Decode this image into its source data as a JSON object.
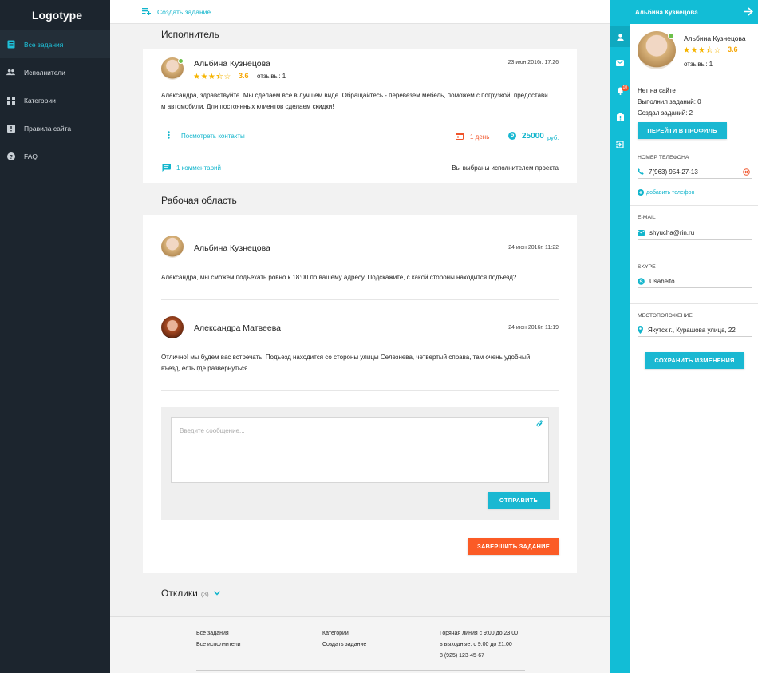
{
  "sidebar": {
    "logo": "Logotype",
    "items": [
      {
        "label": "Все задания",
        "icon": "tasks-icon"
      },
      {
        "label": "Исполнители",
        "icon": "people-icon"
      },
      {
        "label": "Категории",
        "icon": "grid-icon"
      },
      {
        "label": "Правила сайта",
        "icon": "rules-icon"
      },
      {
        "label": "FAQ",
        "icon": "help-icon"
      }
    ]
  },
  "topbar": {
    "create_label": "Создать задание"
  },
  "executor_section": {
    "title": "Исполнитель",
    "card": {
      "name": "Альбина Кузнецова",
      "rating": "3.6",
      "stars": "★★★⯪☆",
      "reviews": "отзывы: 1",
      "date": "23 июн 2016г. 17:26",
      "message_line1": "Александра, здравствуйте. Мы сделаем все в лучшем виде. Обращайтесь - перевезем мебель, поможем с погрузкой, предостави",
      "message_line2": "м автомобили. Для постоянных клиентов сделаем скидки!",
      "contacts_label": "Посмотреть контакты",
      "duration": "1 день",
      "price": "25000",
      "currency": "руб.",
      "comments_label": "1 комментарий",
      "selected_text": "Вы выбраны исполнителем проекта"
    }
  },
  "workspace": {
    "title": "Рабочая область",
    "messages": [
      {
        "name": "Альбина Кузнецова",
        "date": "24 июн 2016г. 11:22",
        "text": "Александра, мы сможем подъехать ровно к 18:00 по вашему адресу. Подскажите, с какой стороны находится подъезд?"
      },
      {
        "name": "Александра Матвеева",
        "date": "24 июн 2016г. 11:19",
        "text_line1": "Отлично! мы будем вас встречать. Подъезд находится со стороны улицы Селезнева, четвертый справа, там очень удобный",
        "text_line2": "въезд, есть где развернуться."
      }
    ],
    "compose_placeholder": "Введите сообщение...",
    "send_label": "ОТПРАВИТЬ",
    "finish_label": "ЗАВЕРШИТЬ ЗАДАНИЕ"
  },
  "responses": {
    "title": "Отклики",
    "count": "(3)"
  },
  "footer": {
    "col1": [
      "Все задания",
      "Все исполнители"
    ],
    "col2": [
      "Категории",
      "Создать задание"
    ],
    "col3": [
      "Горячая линия с 9:00 до 23:00",
      "в выходные: с 9:00 до 21:00",
      "8 (925) 123-45-67"
    ]
  },
  "profile_panel": {
    "header_name": "Альбина Кузнецова",
    "name": "Альбина Кузнецова",
    "rating": "3.6",
    "stars": "★★★⯪☆",
    "reviews": "отзывы: 1",
    "status": "Нет на сайте",
    "completed": "Выполнил заданий: 0",
    "created": "Создал заданий: 2",
    "profile_button": "ПЕРЕЙТИ В ПРОФИЛЬ",
    "phone_label": "НОМЕР ТЕЛЕФОНА",
    "phone": "7(963) 954-27-13",
    "add_phone": "добавить телефон",
    "email_label": "E-MAIL",
    "email": "shyucha@rin.ru",
    "skype_label": "SKYPE",
    "skype": "Usaheito",
    "location_label": "МЕСТОПОЛОЖЕНИЕ",
    "location": "Якутск г., Курашова улица, 22",
    "save_button": "СОХРАНИТЬ ИЗМЕНЕНИЯ",
    "notification_badge": "10"
  },
  "colors": {
    "accent": "#12bdd6",
    "orange": "#fb5b26",
    "sidebar": "#1c252e",
    "star": "#f6b400"
  }
}
